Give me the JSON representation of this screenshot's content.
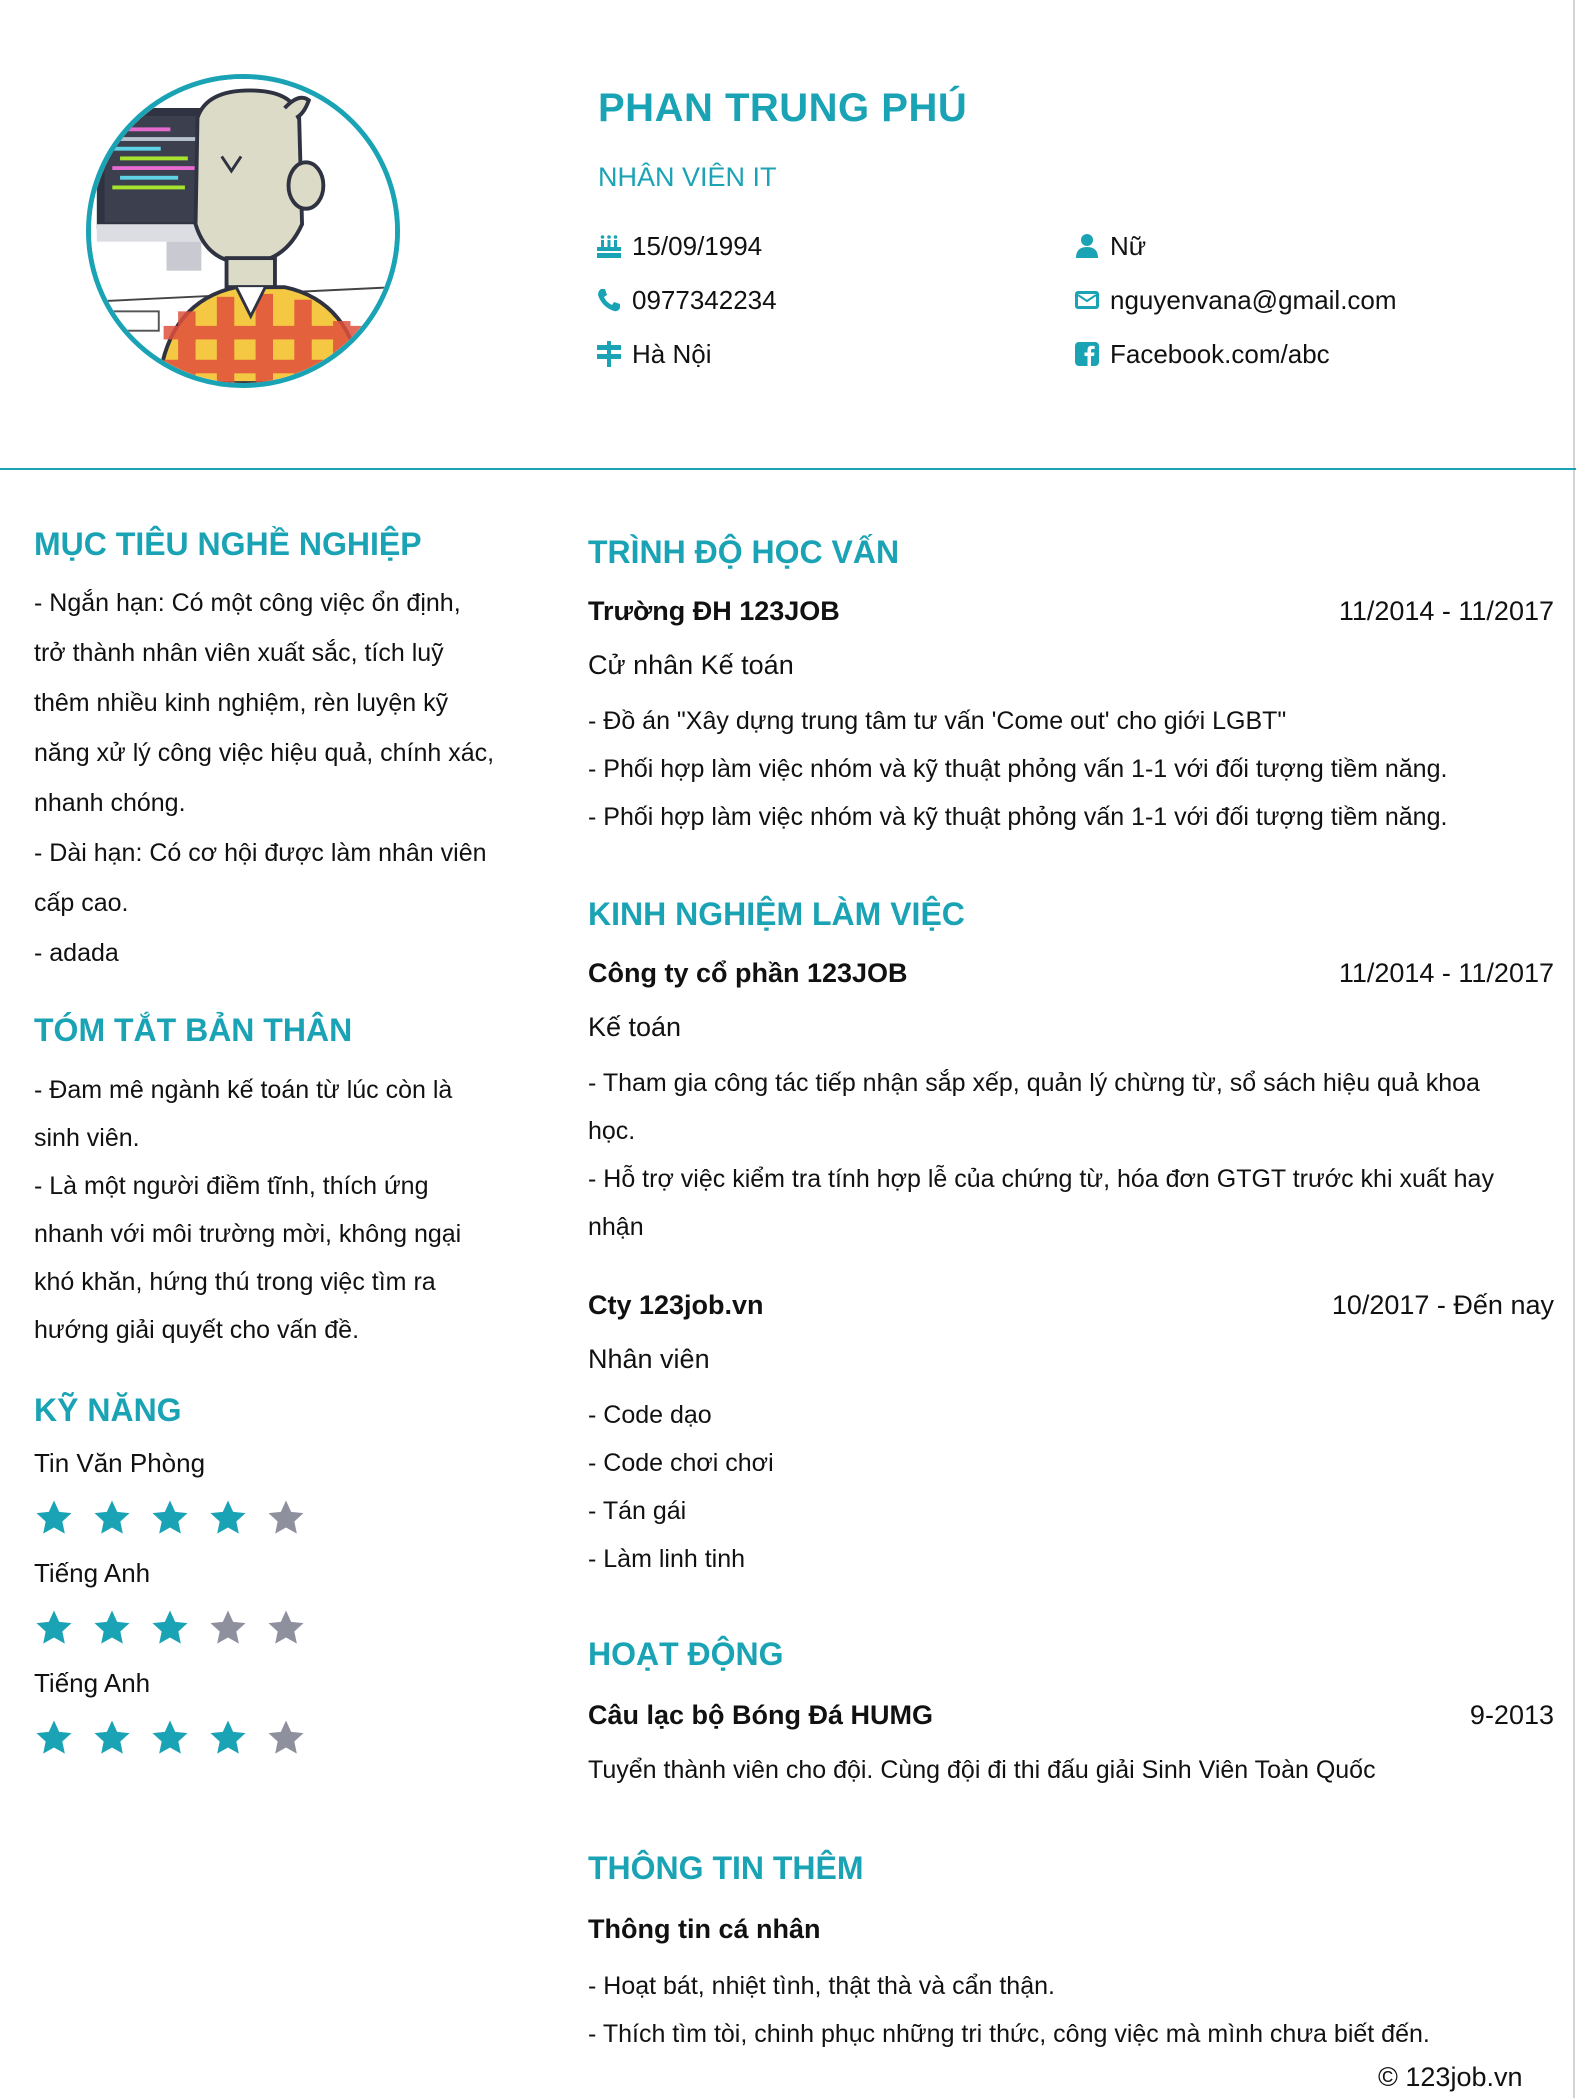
{
  "profile": {
    "name": "PHAN TRUNG PHÚ",
    "position": "NHÂN VIÊN IT",
    "birthday": "15/09/1994",
    "gender": "Nữ",
    "phone": "0977342234",
    "email": "nguyenvana@gmail.com",
    "address": "Hà Nội",
    "facebook": "Facebook.com/abc"
  },
  "objective": {
    "title": "MỤC TIÊU NGHỀ NGHIỆP",
    "lines": [
      "-  Ngắn hạn: Có một công việc ổn định,",
      "trở thành nhân viên xuất sắc, tích luỹ",
      "thêm nhiều kinh nghiệm, rèn luyện kỹ",
      "năng xử lý công việc hiệu quả, chính xác,",
      "nhanh chóng.",
      "- Dài hạn: Có cơ hội được làm nhân viên",
      "cấp cao.",
      "- adada"
    ]
  },
  "summary": {
    "title": "TÓM TẮT BẢN THÂN",
    "lines": [
      "- Đam mê ngành kế toán từ lúc còn là",
      "sinh viên.",
      "- Là một người điềm tĩnh, thích ứng",
      "nhanh với môi trường mời, không ngại",
      "khó khăn, hứng thú trong việc tìm ra",
      "hướng giải quyết cho vấn đề."
    ]
  },
  "skills": {
    "title": "KỸ NĂNG",
    "items": [
      {
        "name": "Tin Văn Phòng",
        "rating": 4,
        "max": 5
      },
      {
        "name": "Tiếng Anh",
        "rating": 3,
        "max": 5
      },
      {
        "name": "Tiếng Anh",
        "rating": 4,
        "max": 5
      }
    ]
  },
  "education": {
    "title": "TRÌNH ĐỘ HỌC VẤN",
    "school": "Trường ĐH 123JOB",
    "date": "11/2014 - 11/2017",
    "degree": "Cử nhân Kế toán",
    "lines": [
      "- Đồ án \"Xây dựng trung tâm tư vấn 'Come out' cho giới LGBT\"",
      "- Phối hợp làm việc nhóm và kỹ thuật phỏng vấn 1-1 với đối tượng tiềm năng.",
      "- Phối hợp làm việc nhóm và kỹ thuật phỏng vấn 1-1 với đối tượng tiềm năng."
    ]
  },
  "experience": {
    "title": "KINH NGHIỆM LÀM VIỆC",
    "jobs": [
      {
        "company": "Công ty cổ phần 123JOB",
        "date": "11/2014 - 11/2017",
        "role": "Kế toán",
        "lines": [
          "- Tham gia công tác tiếp nhận sắp xếp, quản lý chừng từ, sổ sách hiệu quả khoa",
          "học.",
          "- Hỗ trợ việc kiểm tra tính hợp lễ của chứng từ, hóa đơn GTGT trước khi xuất hay",
          "nhận"
        ]
      },
      {
        "company": "Cty 123job.vn",
        "date": "10/2017 - Đến nay",
        "role": "Nhân viên",
        "lines": [
          "- Code dạo",
          "- Code chơi chơi",
          "- Tán gái",
          "- Làm linh tinh"
        ]
      }
    ]
  },
  "activities": {
    "title": "HOẠT ĐỘNG",
    "org": "Câu lạc bộ Bóng Đá HUMG",
    "date": "9-2013",
    "desc": "Tuyển thành viên cho đội. Cùng đội đi thi đấu giải Sinh Viên Toàn Quốc"
  },
  "extra": {
    "title": "THÔNG TIN THÊM",
    "subtitle": "Thông tin cá nhân",
    "lines": [
      "- Hoạt bát, nhiệt tình, thật thà và cẩn thận.",
      "- Thích tìm tòi, chinh phục những tri thức, công việc mà mình chưa biết đến."
    ]
  },
  "footer": {
    "text": "© 123job.vn"
  },
  "colors": {
    "accent": "#1aa3b4",
    "star_on": "#1aa3b4",
    "star_off": "#8e909e"
  }
}
